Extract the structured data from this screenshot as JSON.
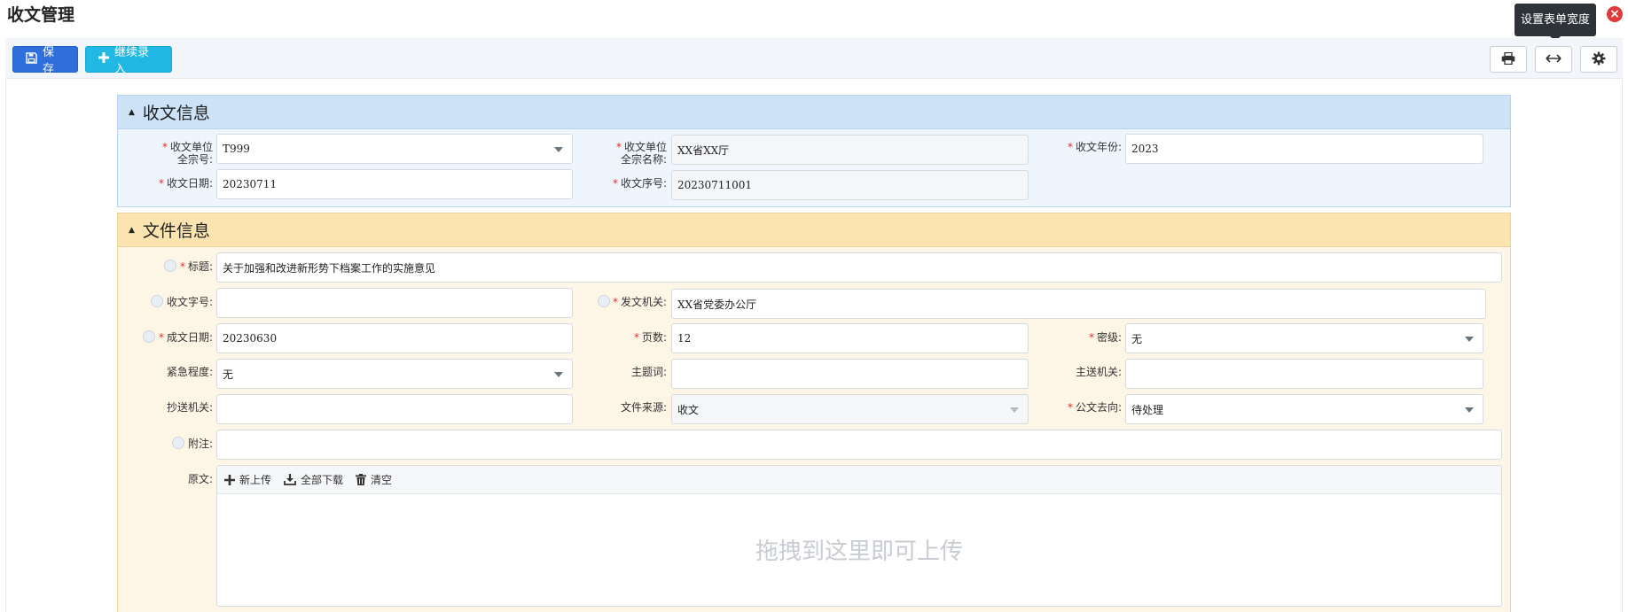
{
  "page": {
    "title": "收文管理"
  },
  "tooltip": {
    "text": "设置表单宽度"
  },
  "toolbar": {
    "save_label": "保存",
    "continue_label": "继续录入"
  },
  "icons": {
    "save": "floppy-disk-icon",
    "plus": "plus-icon",
    "print": "printer-icon",
    "width": "arrows-horizontal-icon",
    "settings": "gear-icon",
    "close": "close-icon",
    "upload": "plus-icon",
    "download": "download-icon",
    "clear": "trash-icon"
  },
  "colors": {
    "primary": "#2f6fdc",
    "info": "#22b8e6",
    "danger": "#e03a3a",
    "required": "#e22c2c"
  },
  "section_receive": {
    "title": "收文信息",
    "unit_code_label_1": "收文单位",
    "unit_code_label_2": "全宗号:",
    "unit_code_value": "T999",
    "unit_name_label_1": "收文单位",
    "unit_name_label_2": "全宗名称:",
    "unit_name_value": "XX省XX厅",
    "year_label": "收文年份:",
    "year_value": "2023",
    "date_label": "收文日期:",
    "date_value": "20230711",
    "serial_label": "收文序号:",
    "serial_value": "20230711001"
  },
  "section_file": {
    "title": "文件信息",
    "subject_label": "标题:",
    "subject_value": "关于加强和改进新形势下档案工作的实施意见",
    "doc_number_label": "收文字号:",
    "doc_number_value": "",
    "issuer_label": "发文机关:",
    "issuer_value": "XX省党委办公厅",
    "form_date_label": "成文日期:",
    "form_date_value": "20230630",
    "pages_label": "页数:",
    "pages_value": "12",
    "secret_label": "密级:",
    "secret_value": "无",
    "urgency_label": "紧急程度:",
    "urgency_value": "无",
    "keywords_label": "主题词:",
    "keywords_value": "",
    "main_recipient_label": "主送机关:",
    "main_recipient_value": "",
    "cc_label": "抄送机关:",
    "cc_value": "",
    "source_label": "文件来源:",
    "source_value": "收文",
    "direction_label": "公文去向:",
    "direction_value": "待处理",
    "remark_label": "附注:",
    "remark_value": "",
    "original_label": "原文:",
    "upload_new": "新上传",
    "download_all": "全部下载",
    "clear": "清空",
    "drop_hint": "拖拽到这里即可上传"
  }
}
